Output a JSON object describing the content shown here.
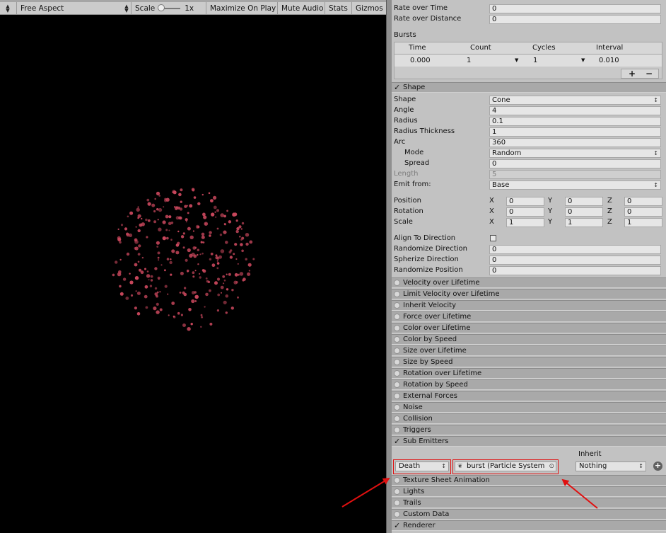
{
  "game_toolbar": {
    "aspect": "Free Aspect",
    "scale_label": "Scale",
    "scale_value": "1x",
    "maximize": "Maximize On Play",
    "mute": "Mute Audio",
    "stats": "Stats",
    "gizmos": "Gizmos"
  },
  "emission": {
    "rate_time_label": "Rate over Time",
    "rate_time_value": "0",
    "rate_distance_label": "Rate over Distance",
    "rate_distance_value": "0",
    "bursts_label": "Bursts",
    "bursts_headers": [
      "Time",
      "Count",
      "Cycles",
      "Interval"
    ],
    "burst_row": {
      "time": "0.000",
      "count": "1",
      "cycles": "1",
      "interval": "0.010"
    },
    "add_label": "+",
    "remove_label": "−"
  },
  "shape": {
    "module_title": "Shape",
    "shape_label": "Shape",
    "shape_value": "Cone",
    "angle_label": "Angle",
    "angle_value": "4",
    "radius_label": "Radius",
    "radius_value": "0.1",
    "thickness_label": "Radius Thickness",
    "thickness_value": "1",
    "arc_label": "Arc",
    "arc_value": "360",
    "mode_label": "Mode",
    "mode_value": "Random",
    "spread_label": "Spread",
    "spread_value": "0",
    "length_label": "Length",
    "length_value": "5",
    "emit_label": "Emit from:",
    "emit_value": "Base",
    "position_label": "Position",
    "position": {
      "x": "0",
      "y": "0",
      "z": "0"
    },
    "rotation_label": "Rotation",
    "rotation": {
      "x": "0",
      "y": "0",
      "z": "0"
    },
    "scale_label": "Scale",
    "scale": {
      "x": "1",
      "y": "1",
      "z": "1"
    },
    "axis_x": "X",
    "axis_y": "Y",
    "axis_z": "Z",
    "align_label": "Align To Direction",
    "rand_dir_label": "Randomize Direction",
    "rand_dir_value": "0",
    "spherize_label": "Spherize Direction",
    "spherize_value": "0",
    "rand_pos_label": "Randomize Position",
    "rand_pos_value": "0"
  },
  "modules": [
    "Velocity over Lifetime",
    "Limit Velocity over Lifetime",
    "Inherit Velocity",
    "Force over Lifetime",
    "Color over Lifetime",
    "Color by Speed",
    "Size over Lifetime",
    "Size by Speed",
    "Rotation over Lifetime",
    "Rotation by Speed",
    "External Forces",
    "Noise",
    "Collision",
    "Triggers"
  ],
  "sub_emitters": {
    "module_title": "Sub Emitters",
    "inherit_label": "Inherit",
    "type_value": "Death",
    "emitter_value": "burst (Particle System",
    "inherit_value": "Nothing",
    "add_label": "+"
  },
  "modules_after": [
    "Texture Sheet Animation",
    "Lights",
    "Trails",
    "Custom Data"
  ],
  "renderer": {
    "module_title": "Renderer"
  },
  "colors": {
    "particle": "#c8475c",
    "annotation": "#e01010"
  }
}
